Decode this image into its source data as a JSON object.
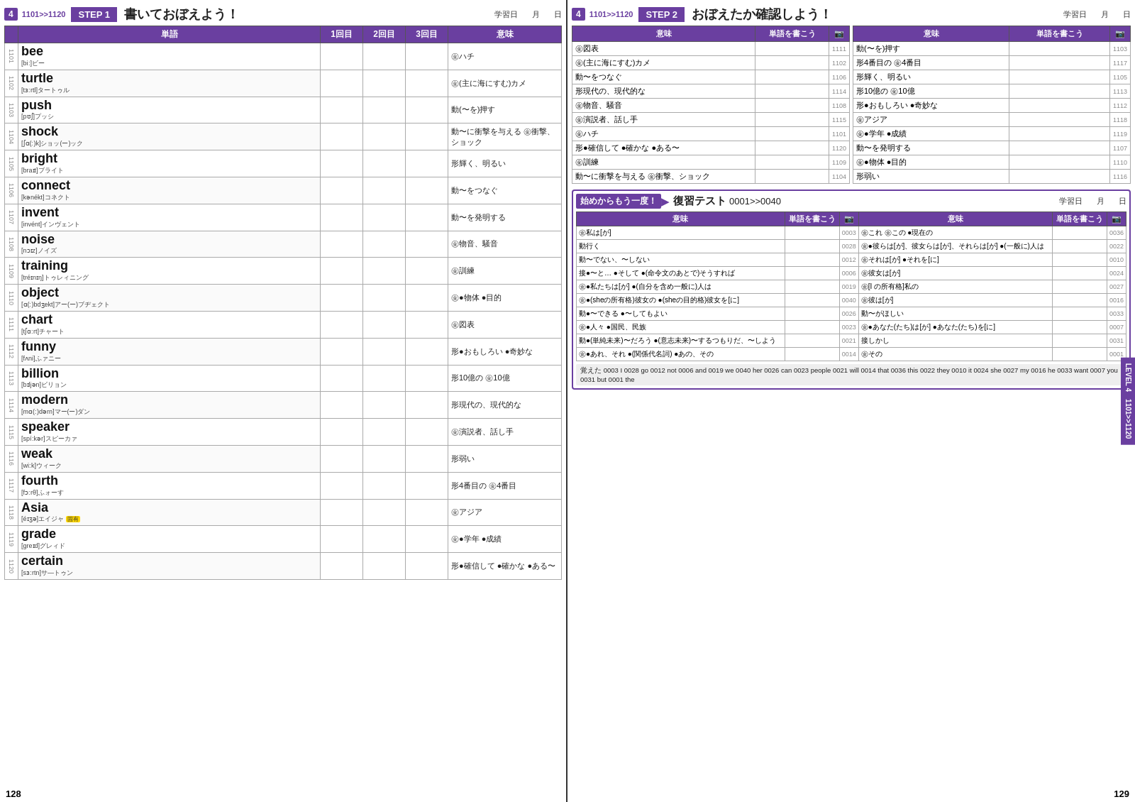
{
  "left_page": {
    "level": "4",
    "range": "1101>>1120",
    "step": "STEP 1",
    "step_title": "書いておぼえよう！",
    "study_date_label": "学習日",
    "month_label": "月",
    "day_label": "日",
    "columns": [
      "単語",
      "1回目",
      "2回目",
      "3回目",
      "意味"
    ],
    "words": [
      {
        "num": "1101",
        "word": "bee",
        "phonetic": "[biː]ビー",
        "meaning": "㊎ハチ"
      },
      {
        "num": "1102",
        "word": "turtle",
        "phonetic": "[tɜːrtl]タートゥル",
        "meaning": "㊎(主に海にすむ)カメ"
      },
      {
        "num": "1103",
        "word": "push",
        "phonetic": "[pʊʃ]プッシ",
        "meaning": "動(〜を)押す"
      },
      {
        "num": "1104",
        "word": "shock",
        "phonetic": "[ʃɑ(ː)k]ショッ(ー)ック",
        "meaning": "動〜に衝撃を与える ㊎衝撃、ショック"
      },
      {
        "num": "1105",
        "word": "bright",
        "phonetic": "[braɪt]ブライト",
        "meaning": "形輝く、明るい"
      },
      {
        "num": "1106",
        "word": "connect",
        "phonetic": "[kənékt]コネクト",
        "meaning": "動〜をつなぐ"
      },
      {
        "num": "1107",
        "word": "invent",
        "phonetic": "[invént]インヴェント",
        "meaning": "動〜を発明する"
      },
      {
        "num": "1108",
        "word": "noise",
        "phonetic": "[nɔɪz]ノイズ",
        "meaning": "㊎物音、騒音"
      },
      {
        "num": "1109",
        "word": "training",
        "phonetic": "[tréɪnɪŋ]トゥレィニング",
        "meaning": "㊎訓練"
      },
      {
        "num": "1110",
        "word": "object",
        "phonetic": "[ɑ(ː)bdʒekt]アー(ー)ブヂェクト",
        "meaning": "㊎●物体 ●目的"
      },
      {
        "num": "1111",
        "word": "chart",
        "phonetic": "[tʃɑːrt]チャート",
        "meaning": "㊎図表"
      },
      {
        "num": "1112",
        "word": "funny",
        "phonetic": "[fʌni]ふァニー",
        "meaning": "形●おもしろい ●奇妙な"
      },
      {
        "num": "1113",
        "word": "billion",
        "phonetic": "[bɪljən]ビリョン",
        "meaning": "形10億の ㊎10億"
      },
      {
        "num": "1114",
        "word": "modern",
        "phonetic": "[mɑ(ː)dərn]マー(ー)ダン",
        "meaning": "形現代の、現代的な"
      },
      {
        "num": "1115",
        "word": "speaker",
        "phonetic": "[spíːkər]スピーカァ",
        "meaning": "㊎演説者、話し手"
      },
      {
        "num": "1116",
        "word": "weak",
        "phonetic": "[wiːk]ウィーク",
        "meaning": "形弱い"
      },
      {
        "num": "1117",
        "word": "fourth",
        "phonetic": "[fɔːrθ]ふォーす",
        "meaning": "形4番目の ㊎4番目"
      },
      {
        "num": "1118",
        "word": "Asia",
        "phonetic": "[éɪʒə]エイジャ",
        "meaning": "㊎アジア",
        "tag": "固有"
      },
      {
        "num": "1119",
        "word": "grade",
        "phonetic": "[greɪd]グレィド",
        "meaning": "㊎●学年 ●成績"
      },
      {
        "num": "1120",
        "word": "certain",
        "phonetic": "[sɜːrtn]サ―トゥン",
        "meaning": "形●確信して ●確かな ●ある〜"
      }
    ],
    "page_num": "128"
  },
  "right_page": {
    "level": "4",
    "range": "1101>>1120",
    "step": "STEP 2",
    "step_title": "おぼえたか確認しよう！",
    "study_date_label": "学習日",
    "month_label": "月",
    "day_label": "日",
    "confirm_left": {
      "col1": "意味",
      "col2": "単語を書こう",
      "rows": [
        {
          "meaning": "㊎図表",
          "num": "1111"
        },
        {
          "meaning": "㊎(主に海にすむ)カメ",
          "num": "1102"
        },
        {
          "meaning": "動〜をつなぐ",
          "num": "1106"
        },
        {
          "meaning": "形現代の、現代的な",
          "num": "1114"
        },
        {
          "meaning": "㊎物音、騒音",
          "num": "1108"
        },
        {
          "meaning": "㊎演説者、話し手",
          "num": "1115"
        },
        {
          "meaning": "㊎ハチ",
          "num": "1101"
        },
        {
          "meaning": "形●確信して ●確かな ●ある〜",
          "num": "1120"
        },
        {
          "meaning": "㊎訓練",
          "num": "1109"
        },
        {
          "meaning": "動〜に衝撃を与える ㊎衝撃、ショック",
          "num": "1104"
        }
      ]
    },
    "confirm_right": {
      "col1": "意味",
      "col2": "単語を書こう",
      "rows": [
        {
          "meaning": "動(〜を)押す",
          "num": "1103"
        },
        {
          "meaning": "形4番目の ㊎4番目",
          "num": "1117"
        },
        {
          "meaning": "形輝く、明るい",
          "num": "1105"
        },
        {
          "meaning": "形10億の ㊎10億",
          "num": "1113"
        },
        {
          "meaning": "形●おもしろい ●奇妙な",
          "num": "1112"
        },
        {
          "meaning": "㊎アジア",
          "num": "1118"
        },
        {
          "meaning": "㊎●学年 ●成績",
          "num": "1119"
        },
        {
          "meaning": "動〜を発明する",
          "num": "1107"
        },
        {
          "meaning": "㊎●物体 ●目的",
          "num": "1110"
        },
        {
          "meaning": "形弱い",
          "num": "1116"
        }
      ]
    },
    "review": {
      "badge": "始めからもう一度！",
      "arrow": "▶",
      "title": "復習テスト",
      "range": "0001>>0040",
      "study_date_label": "学習日",
      "month_label": "月",
      "day_label": "日",
      "col1": "意味",
      "col2": "単語を書こう",
      "col3": "意味",
      "col4": "単語を書こう",
      "rows": [
        {
          "meaning_l": "㊎私は[が]",
          "num_l": "0003",
          "meaning_r": "㊎これ ㊎この ●現在の",
          "num_r": "0036"
        },
        {
          "meaning_l": "動行く",
          "num_l": "0028",
          "meaning_r": "㊎●彼らは[が]、彼女らは[が]、それらは[が] ●(一般に)人は",
          "num_r": "0022"
        },
        {
          "meaning_l": "動〜でない、〜しない",
          "num_l": "0012",
          "meaning_r": "㊎それは[が] ●それを[に]",
          "num_r": "0010"
        },
        {
          "meaning_l": "接●〜と… ●そして ●(命令文のあとで)そうすれば",
          "num_l": "0006",
          "meaning_r": "㊎彼女は[が]",
          "num_r": "0024"
        },
        {
          "meaning_l": "㊎●私たちは[が] ●(自分を含め一般に)人は",
          "num_l": "0019",
          "meaning_r": "㊎[I の所有格]私の",
          "num_r": "0027"
        },
        {
          "meaning_l": "㊎●(sheの所有格)彼女の ●(sheの目的格)彼女を[に]",
          "num_l": "0040",
          "meaning_r": "㊎彼は[が]",
          "num_r": "0016"
        },
        {
          "meaning_l": "動●〜できる ●〜してもよい",
          "num_l": "0026",
          "meaning_r": "動〜がほしい",
          "num_r": "0033"
        },
        {
          "meaning_l": "㊎●人々 ●国民、民族",
          "num_l": "0023",
          "meaning_r": "㊎●あなた(たち)は[が] ●あなた(たち)を[に]",
          "num_r": "0007"
        },
        {
          "meaning_l": "動●(単純未来)〜だろう ●(意志未来)〜するつもりだ、〜しよう",
          "num_l": "0021",
          "meaning_r": "接しかし",
          "num_r": "0031"
        },
        {
          "meaning_l": "㊎●あれ、それ ●(関係代名詞) ●あの、その",
          "num_l": "0014",
          "meaning_r": "㊎その",
          "num_r": "0001"
        }
      ],
      "footer": "覚えた 0003 I  0028 go  0012 not  0006 and  0019 we  0040 her  0026 can  0023 people  0021 will  0014 that  0036 this  0022 they  0010 it  0024 she  0027 my  0016 he  0033 want  0007 you  0031 but  0001 the"
    },
    "page_num": "129",
    "side_label": "LEVEL 4  1101>>1120"
  }
}
